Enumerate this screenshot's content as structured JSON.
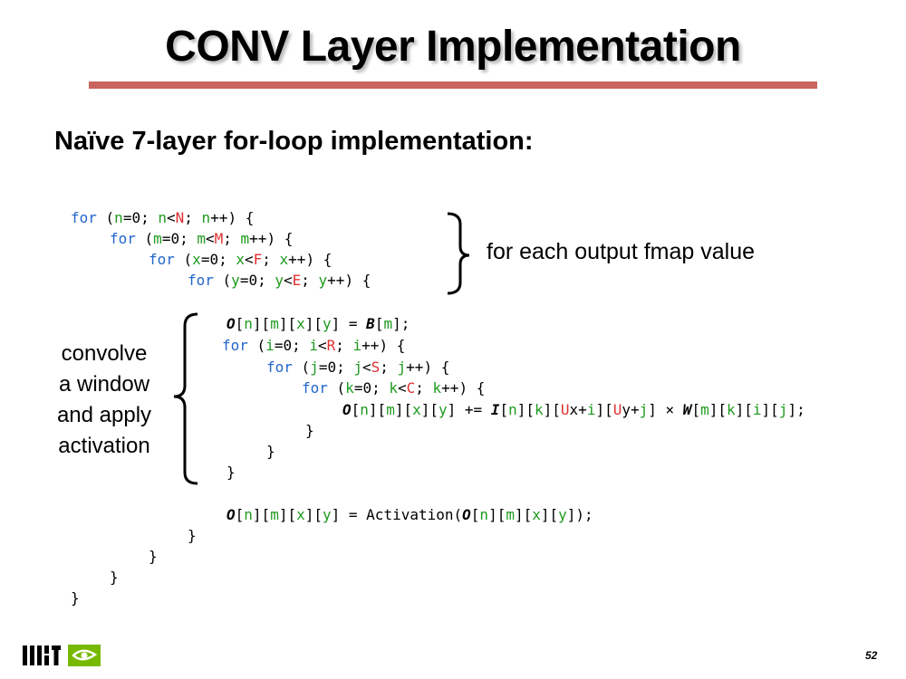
{
  "slide": {
    "title": "CONV Layer Implementation",
    "subtitle": "Naïve 7-layer for-loop implementation:",
    "page_number": "52"
  },
  "annotations": {
    "left_label_lines": [
      "convolve",
      "a window",
      "and apply",
      "activation"
    ],
    "right_label": "for each output fmap value"
  },
  "code": {
    "line1": {
      "kw": "for",
      "t1": " (",
      "v1": "n",
      "t2": "=0; ",
      "v2": "n",
      "t3": "<",
      "lim": "N",
      "t4": "; ",
      "v3": "n",
      "t5": "++) {"
    },
    "line2": {
      "kw": "for",
      "t1": " (",
      "v1": "m",
      "t2": "=0; ",
      "v2": "m",
      "t3": "<",
      "lim": "M",
      "t4": "; ",
      "v3": "m",
      "t5": "++) {"
    },
    "line3": {
      "kw": "for",
      "t1": " (",
      "v1": "x",
      "t2": "=0; ",
      "v2": "x",
      "t3": "<",
      "lim": "F",
      "t4": "; ",
      "v3": "x",
      "t5": "++) {"
    },
    "line4": {
      "kw": "for",
      "t1": " (",
      "v1": "y",
      "t2": "=0; ",
      "v2": "y",
      "t3": "<",
      "lim": "E",
      "t4": "; ",
      "v3": "y",
      "t5": "++) {"
    },
    "line5": {
      "o": "O",
      "t1": "[",
      "n": "n",
      "t2": "][",
      "m": "m",
      "t3": "][",
      "x": "x",
      "t4": "][",
      "y": "y",
      "t5": "] = ",
      "b": "B",
      "t6": "[",
      "m2": "m",
      "t7": "];"
    },
    "line6": {
      "kw": "for",
      "t1": " (",
      "v1": "i",
      "t2": "=0; ",
      "v2": "i",
      "t3": "<",
      "lim": "R",
      "t4": "; ",
      "v3": "i",
      "t5": "++) {"
    },
    "line7": {
      "kw": "for",
      "t1": " (",
      "v1": "j",
      "t2": "=0; ",
      "v2": "j",
      "t3": "<",
      "lim": "S",
      "t4": "; ",
      "v3": "j",
      "t5": "++) {"
    },
    "line8": {
      "kw": "for",
      "t1": " (",
      "v1": "k",
      "t2": "=0; ",
      "v2": "k",
      "t3": "<",
      "lim": "C",
      "t4": "; ",
      "v3": "k",
      "t5": "++) {"
    },
    "line9": {
      "o": "O",
      "a1": "[",
      "n": "n",
      "a2": "][",
      "m": "m",
      "a3": "][",
      "x": "x",
      "a4": "][",
      "y": "y",
      "a5": "] += ",
      "i": "I",
      "b1": "[",
      "n2": "n",
      "b2": "][",
      "k": "k",
      "b3": "][",
      "ux": "U",
      "b4": "x+",
      "i2": "i",
      "b5": "][",
      "uy": "U",
      "b6": "y+",
      "j": "j",
      "b7": "] × ",
      "w": "W",
      "c1": "[",
      "m2": "m",
      "c2": "][",
      "k2": "k",
      "c3": "][",
      "i3": "i",
      "c4": "][",
      "j2": "j",
      "c5": "];"
    },
    "close_brace": "}",
    "line_act": {
      "o": "O",
      "a1": "[",
      "n": "n",
      "a2": "][",
      "m": "m",
      "a3": "][",
      "x": "x",
      "a4": "][",
      "y": "y",
      "a5": "] = Activation(",
      "o2": "O",
      "b1": "[",
      "n2": "n",
      "b2": "][",
      "m2": "m",
      "b3": "][",
      "x2": "x",
      "b4": "][",
      "y2": "y",
      "b5": "]);"
    }
  },
  "colors": {
    "keyword": "#2266cc",
    "variable": "#1f9a1f",
    "limit": "#e03030",
    "title_rule": "#c9645e",
    "logo_green": "#76b900"
  },
  "logos": {
    "left": "mit-logo",
    "right": "nvidia-logo"
  }
}
